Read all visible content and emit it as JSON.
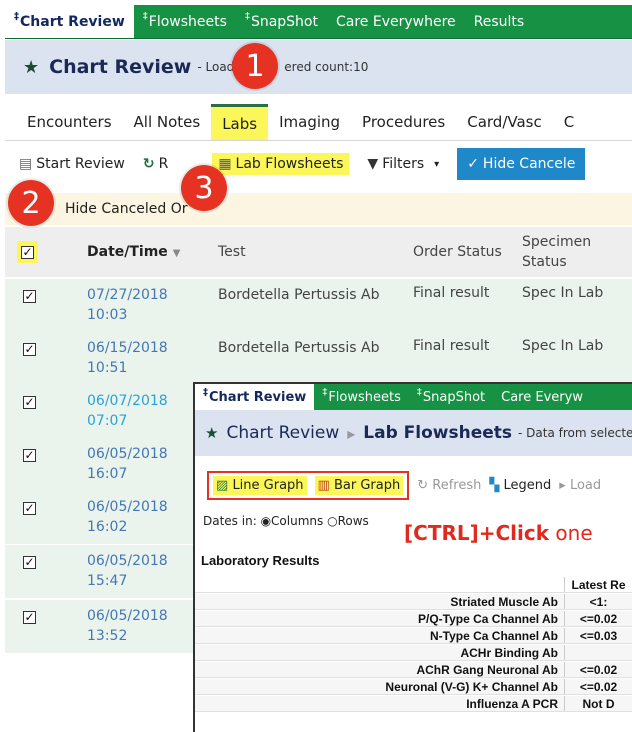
{
  "tabs": [
    {
      "label": "Chart Review",
      "pin": "‡"
    },
    {
      "label": "Flowsheets",
      "pin": "‡"
    },
    {
      "label": "SnapShot",
      "pin": "‡"
    },
    {
      "label": "Care Everywhere",
      "pin": ""
    },
    {
      "label": "Results",
      "pin": ""
    }
  ],
  "title": {
    "text": "Chart Review",
    "sub_left": "- Load",
    "sub_right": "ered count:10"
  },
  "activity": [
    "Encounters",
    "All Notes",
    "Labs",
    "Imaging",
    "Procedures",
    "Card/Vasc",
    "C"
  ],
  "toolbar": {
    "start_review": "Start Review",
    "refresh": "R",
    "lab_flowsheets": "Lab Flowsheets",
    "filters": "Filters",
    "hide_canceled": "Hide Cancele"
  },
  "note": "Hide Canceled Or",
  "badges": [
    "1",
    "2",
    "3"
  ],
  "columns": {
    "date": "Date/Time",
    "test": "Test",
    "order": "Order Status",
    "specimen_1": "Specimen",
    "specimen_2": "Status"
  },
  "rows": [
    {
      "date": "07/27/2018",
      "time": "10:03",
      "test": "Bordetella Pertussis Ab",
      "order": "Final result",
      "spec": "Spec In Lab"
    },
    {
      "date": "06/15/2018",
      "time": "10:51",
      "test": "Bordetella Pertussis Ab",
      "order": "Final result",
      "spec": "Spec In Lab"
    },
    {
      "date": "06/07/2018",
      "time": "07:07",
      "test": "",
      "order": "",
      "spec": ""
    },
    {
      "date": "06/05/2018",
      "time": "16:07",
      "test": "",
      "order": "",
      "spec": ""
    },
    {
      "date": "06/05/2018",
      "time": "16:02",
      "test": "",
      "order": "",
      "spec": ""
    },
    {
      "date": "06/05/2018",
      "time": "15:47",
      "test": "",
      "order": "",
      "spec": ""
    },
    {
      "date": "06/05/2018",
      "time": "13:52",
      "test": "",
      "order": "",
      "spec": ""
    }
  ],
  "inset": {
    "tabs": [
      {
        "label": "Chart Review",
        "pin": "‡"
      },
      {
        "label": "Flowsheets",
        "pin": "‡"
      },
      {
        "label": "SnapShot",
        "pin": "‡"
      },
      {
        "label": "Care Everyw",
        "pin": ""
      }
    ],
    "title": "Chart Review",
    "title2": "Lab Flowsheets",
    "sub": "- Data from selecte",
    "line_graph": "Line Graph",
    "bar_graph": "Bar Graph",
    "refresh": "Refresh",
    "legend": "Legend",
    "load": "Load",
    "dates_in": "Dates in:",
    "columns": "Columns",
    "rows": "Rows",
    "ctrl_click_bold": "[CTRL]+Click",
    "ctrl_click_rest": " one",
    "section": "Laboratory Results",
    "latest": "Latest Re",
    "results": [
      {
        "name": "Striated Muscle Ab",
        "value": "<1:"
      },
      {
        "name": "P/Q-Type Ca Channel Ab",
        "value": "<=0.02"
      },
      {
        "name": "N-Type Ca Channel Ab",
        "value": "<=0.03"
      },
      {
        "name": "ACHr Binding Ab",
        "value": ""
      },
      {
        "name": "AChR Gang Neuronal Ab",
        "value": "<=0.02"
      },
      {
        "name": "Neuronal (V-G) K+ Channel Ab",
        "value": "<=0.02"
      },
      {
        "name": "Influenza A PCR",
        "value": "Not D"
      }
    ]
  },
  "colors": {
    "tab_green": "#179245",
    "highlight": "#fbf75a",
    "badge_red": "#e63223",
    "date_blue": "#4477b3"
  }
}
